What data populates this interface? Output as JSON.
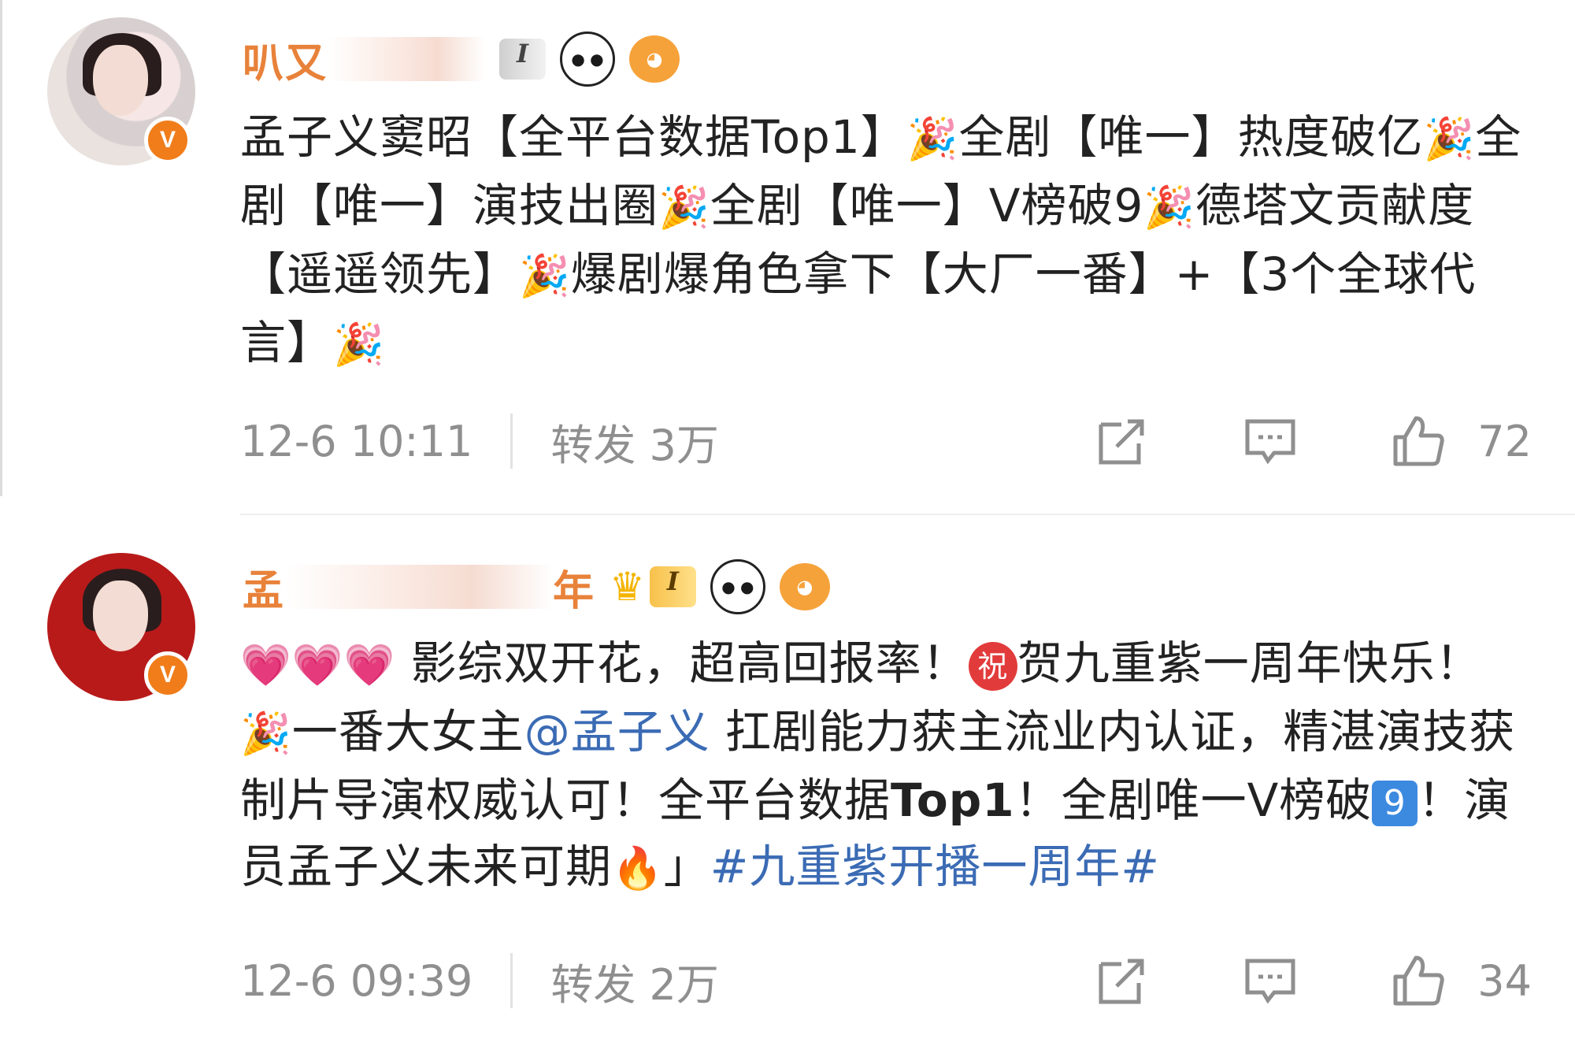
{
  "posts": [
    {
      "username": "叭",
      "username_tail": "又",
      "badge_level": "I",
      "content_parts": [
        {
          "t": "孟子义窦昭【全平台数据Top1】"
        },
        {
          "e": "🎉"
        },
        {
          "t": "全剧【唯一】热度破亿"
        },
        {
          "e": "🎉"
        },
        {
          "t": "全剧【唯一】演技出圈"
        },
        {
          "e": "🎉"
        },
        {
          "t": "全剧【唯一】V榜破9"
        },
        {
          "e": "🎉"
        },
        {
          "t": "德塔文贡献度【遥遥领先】"
        },
        {
          "e": "🎉"
        },
        {
          "t": "爆剧爆角色拿下【大厂一番】+【3个全球代言】"
        },
        {
          "e": "🎉"
        }
      ],
      "time": "12-6 10:11",
      "repost": "转发 3万",
      "likes": "72"
    },
    {
      "username": "孟",
      "username_tail": "年",
      "badge_level": "I",
      "content": {
        "hearts": "💗💗💗",
        "p1": " 影综双开花，超高回报率！",
        "zhu": "祝",
        "p2": "贺九重紫一周年快乐！",
        "party": "🎉",
        "p3": "一番大女主",
        "mention": "@孟子义",
        "p4": " 扛剧能力获主流业内认证，精湛演技获制片导演权威认可！全平台数据",
        "bold": "Top1",
        "p5": "！全剧唯一V榜破",
        "nine": "9",
        "p6": "！演员孟子义未来可期",
        "fire": "🔥",
        "p7": "」",
        "hashtag": "#九重紫开播一周年#"
      },
      "time": "12-6 09:39",
      "repost": "转发 2万",
      "likes": "34"
    }
  ],
  "icons": {
    "share": "share-icon",
    "comment": "comment-icon",
    "like": "like-icon"
  },
  "colors": {
    "username": "#e8823a",
    "link": "#3b6bb4",
    "verified": "#f07d1a",
    "meta": "#8f8f8f"
  }
}
